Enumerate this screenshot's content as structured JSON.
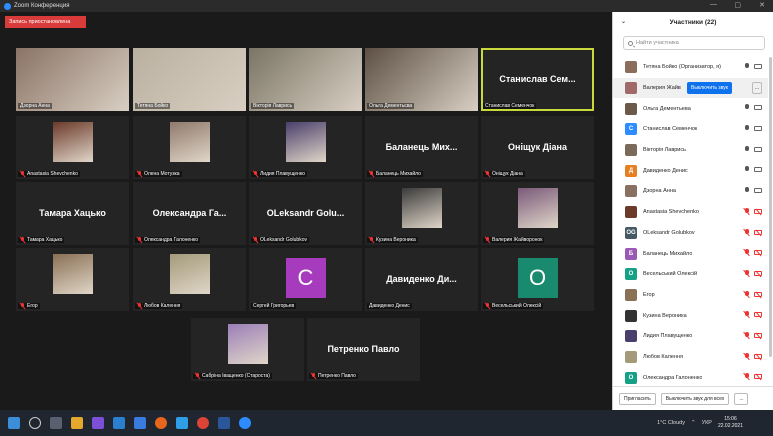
{
  "window": {
    "title": "Zoom Конференция",
    "controls": [
      "—",
      "▢",
      "✕"
    ]
  },
  "recording_badge": "Запись приостановлена",
  "tiles": [
    {
      "name": "Дзорна Анна",
      "kind": "photo",
      "color": "#8a7366",
      "muted": false,
      "active": false
    },
    {
      "name": "Тетяна Бойко",
      "kind": "photo",
      "color": "#b9b0a0",
      "muted": false,
      "active": false
    },
    {
      "name": "Вікторія Лаврись",
      "kind": "photo",
      "color": "#7b7565",
      "muted": false,
      "active": false
    },
    {
      "name": "Ольга Дементьєва",
      "kind": "photo",
      "color": "#5d4f44",
      "muted": false,
      "active": false
    },
    {
      "name": "Станислав Семенчок",
      "kind": "text",
      "big": "Станислав Сем...",
      "muted": false,
      "active": true
    },
    {
      "name": "Anastasia Shevchenko",
      "kind": "thumb",
      "color": "#6b3a2a",
      "muted": true
    },
    {
      "name": "Олена Мотузка",
      "kind": "thumb",
      "color": "#8f7a6d",
      "muted": true
    },
    {
      "name": "Лидия Плавущенко",
      "kind": "thumb",
      "color": "#4a3f6b",
      "muted": true
    },
    {
      "name": "Баланець Михайло",
      "kind": "text",
      "big": "Баланець Мих...",
      "muted": true
    },
    {
      "name": "Оніщук Діана",
      "kind": "text",
      "big": "Оніщук Діана",
      "muted": true
    },
    {
      "name": "Тамара Хацько",
      "kind": "text",
      "big": "Тамара Хацько",
      "muted": true
    },
    {
      "name": "Олександра Галоненко",
      "kind": "text",
      "big": "Олександра Га...",
      "muted": true
    },
    {
      "name": "OLeksandr Golubkov",
      "kind": "text",
      "big": "OLeksandr Golu...",
      "muted": true
    },
    {
      "name": "Кузина Вероника",
      "kind": "thumb",
      "color": "#3a3a3a",
      "muted": true
    },
    {
      "name": "Валерия Жайворонок",
      "kind": "thumb",
      "color": "#7a5a7a",
      "muted": true
    },
    {
      "name": "Егор",
      "kind": "thumb",
      "color": "#8a7054",
      "muted": true
    },
    {
      "name": "Любов Калення",
      "kind": "thumb",
      "color": "#a49a7a",
      "muted": true
    },
    {
      "name": "Сергей Григорьев",
      "kind": "letter",
      "letter": "C",
      "color": "#a63bbd",
      "muted": false
    },
    {
      "name": "Давиденко Денис",
      "kind": "text",
      "big": "Давиденко Ди...",
      "muted": false
    },
    {
      "name": "Весельський Олексій",
      "kind": "letter",
      "letter": "O",
      "color": "#1a8a6e",
      "muted": true
    },
    {
      "name": "Сабріна Іващенко (Староста)",
      "kind": "thumb",
      "color": "#9b7fb8",
      "muted": true
    },
    {
      "name": "Петренко Павло",
      "kind": "text",
      "big": "Петренко Павло",
      "muted": true
    }
  ],
  "panel": {
    "title": "Участники (22)",
    "search_placeholder": "Найти участника",
    "unmute_label": "Выключить звук",
    "more_label": "...",
    "participants": [
      {
        "name": "Тетяна Бойко (Организатор, я)",
        "avatar": "",
        "color": "#8a6d5a",
        "mic": "on",
        "cam": "on"
      },
      {
        "name": "Валерия Жайв",
        "avatar": "",
        "color": "#a06a6a",
        "mic": "",
        "cam": "",
        "hover": true
      },
      {
        "name": "Ольга Дементьева",
        "avatar": "",
        "color": "#6b5a4a",
        "mic": "on",
        "cam": "on"
      },
      {
        "name": "Станислав Семенчок",
        "avatar": "С",
        "color": "#2d8cff",
        "mic": "on",
        "cam": "on"
      },
      {
        "name": "Вікторія Лаврись",
        "avatar": "",
        "color": "#7a6a5a",
        "mic": "on",
        "cam": "on"
      },
      {
        "name": "Давиденко Денис",
        "avatar": "Д",
        "color": "#e67e22",
        "mic": "on",
        "cam": "on"
      },
      {
        "name": "Дзорна Анна",
        "avatar": "",
        "color": "#8a7060",
        "mic": "on",
        "cam": "on"
      },
      {
        "name": "Anastasia Shevchenko",
        "avatar": "",
        "color": "#6b3a2a",
        "mic": "off",
        "cam": "off"
      },
      {
        "name": "OLeksandr Golubkov",
        "avatar": "OG",
        "color": "#455a64",
        "mic": "off",
        "cam": "off"
      },
      {
        "name": "Баланець Михайло",
        "avatar": "Б",
        "color": "#9b59b6",
        "mic": "off",
        "cam": "off"
      },
      {
        "name": "Весельський Олексій",
        "avatar": "О",
        "color": "#16a085",
        "mic": "off",
        "cam": "off"
      },
      {
        "name": "Егор",
        "avatar": "",
        "color": "#8a7054",
        "mic": "off",
        "cam": "off"
      },
      {
        "name": "Кузина Вероника",
        "avatar": "",
        "color": "#333333",
        "mic": "off",
        "cam": "off"
      },
      {
        "name": "Лидия Плавущенко",
        "avatar": "",
        "color": "#4a3f6b",
        "mic": "off",
        "cam": "off"
      },
      {
        "name": "Любов Калення",
        "avatar": "",
        "color": "#a49a7a",
        "mic": "off",
        "cam": "off"
      },
      {
        "name": "Олександра Галоненко",
        "avatar": "О",
        "color": "#16a085",
        "mic": "off",
        "cam": "off"
      }
    ],
    "invite_label": "Пригласить",
    "mute_all_label": "Выключить звук для всех",
    "more_footer": "..."
  },
  "taskbar": {
    "weather": "1°C Cloudy",
    "language": "УКР",
    "time": "15:06",
    "date": "22.02.2021"
  }
}
